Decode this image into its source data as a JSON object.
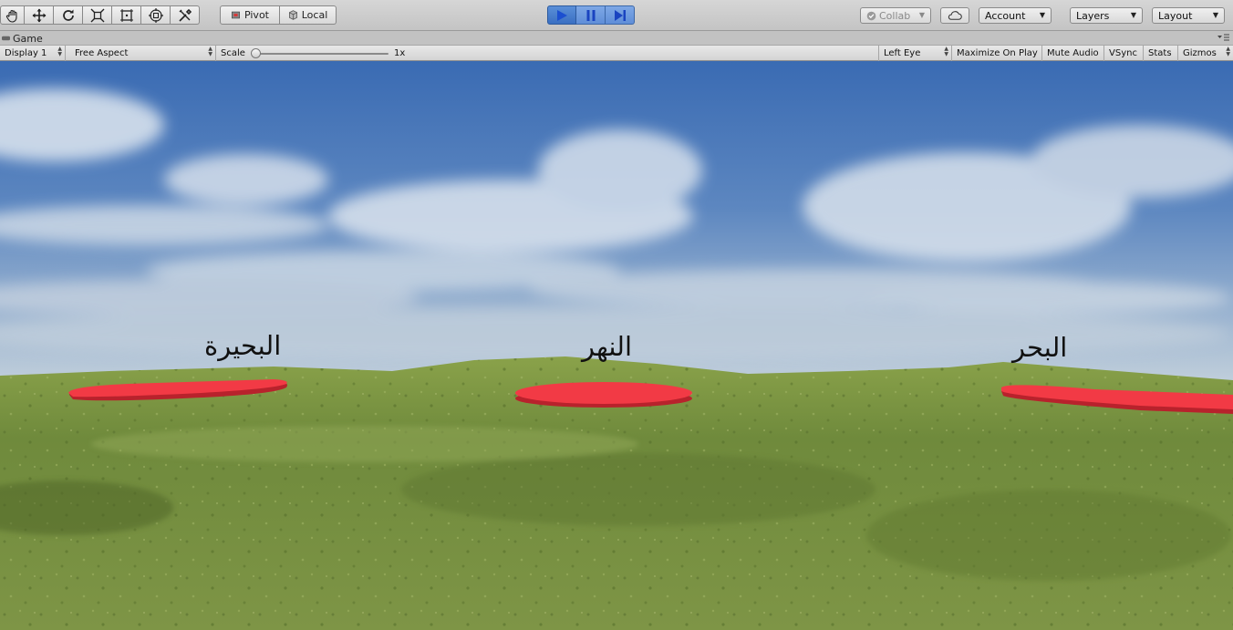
{
  "toolbar": {
    "transform_tools": [
      {
        "name": "hand-tool",
        "icon": "hand-icon"
      },
      {
        "name": "move-tool",
        "icon": "move-arrows-icon"
      },
      {
        "name": "rotate-tool",
        "icon": "rotate-icon"
      },
      {
        "name": "scale-tool",
        "icon": "scale-icon"
      },
      {
        "name": "rect-tool",
        "icon": "rect-icon"
      },
      {
        "name": "transform-tool",
        "icon": "transform-icon"
      },
      {
        "name": "custom-tool",
        "icon": "tools-icon"
      }
    ],
    "pivot_label": "Pivot",
    "local_label": "Local",
    "play_controls": {
      "play": "play-icon",
      "pause": "pause-icon",
      "step": "step-icon"
    },
    "collab_label": "Collab",
    "account_label": "Account",
    "layers_label": "Layers",
    "layout_label": "Layout"
  },
  "game_tab": {
    "title": "Game"
  },
  "game_controls": {
    "display": "Display 1",
    "aspect": "Free Aspect",
    "scale_label": "Scale",
    "scale_value": "1x",
    "scale_level": 0.0,
    "eye": "Left Eye",
    "maximize_on_play": "Maximize On Play",
    "mute_audio": "Mute Audio",
    "vsync": "VSync",
    "stats": "Stats",
    "gizmos": "Gizmos"
  },
  "scene": {
    "labels": {
      "left": "البحيرة",
      "center": "النهر",
      "right": "البحر"
    },
    "colors": {
      "sky_top": "#3f6eb3",
      "sky_horizon": "#b9c9d8",
      "grass": "#6f8a3c",
      "grass_dark": "#53692a",
      "target": "#f23a45"
    }
  }
}
